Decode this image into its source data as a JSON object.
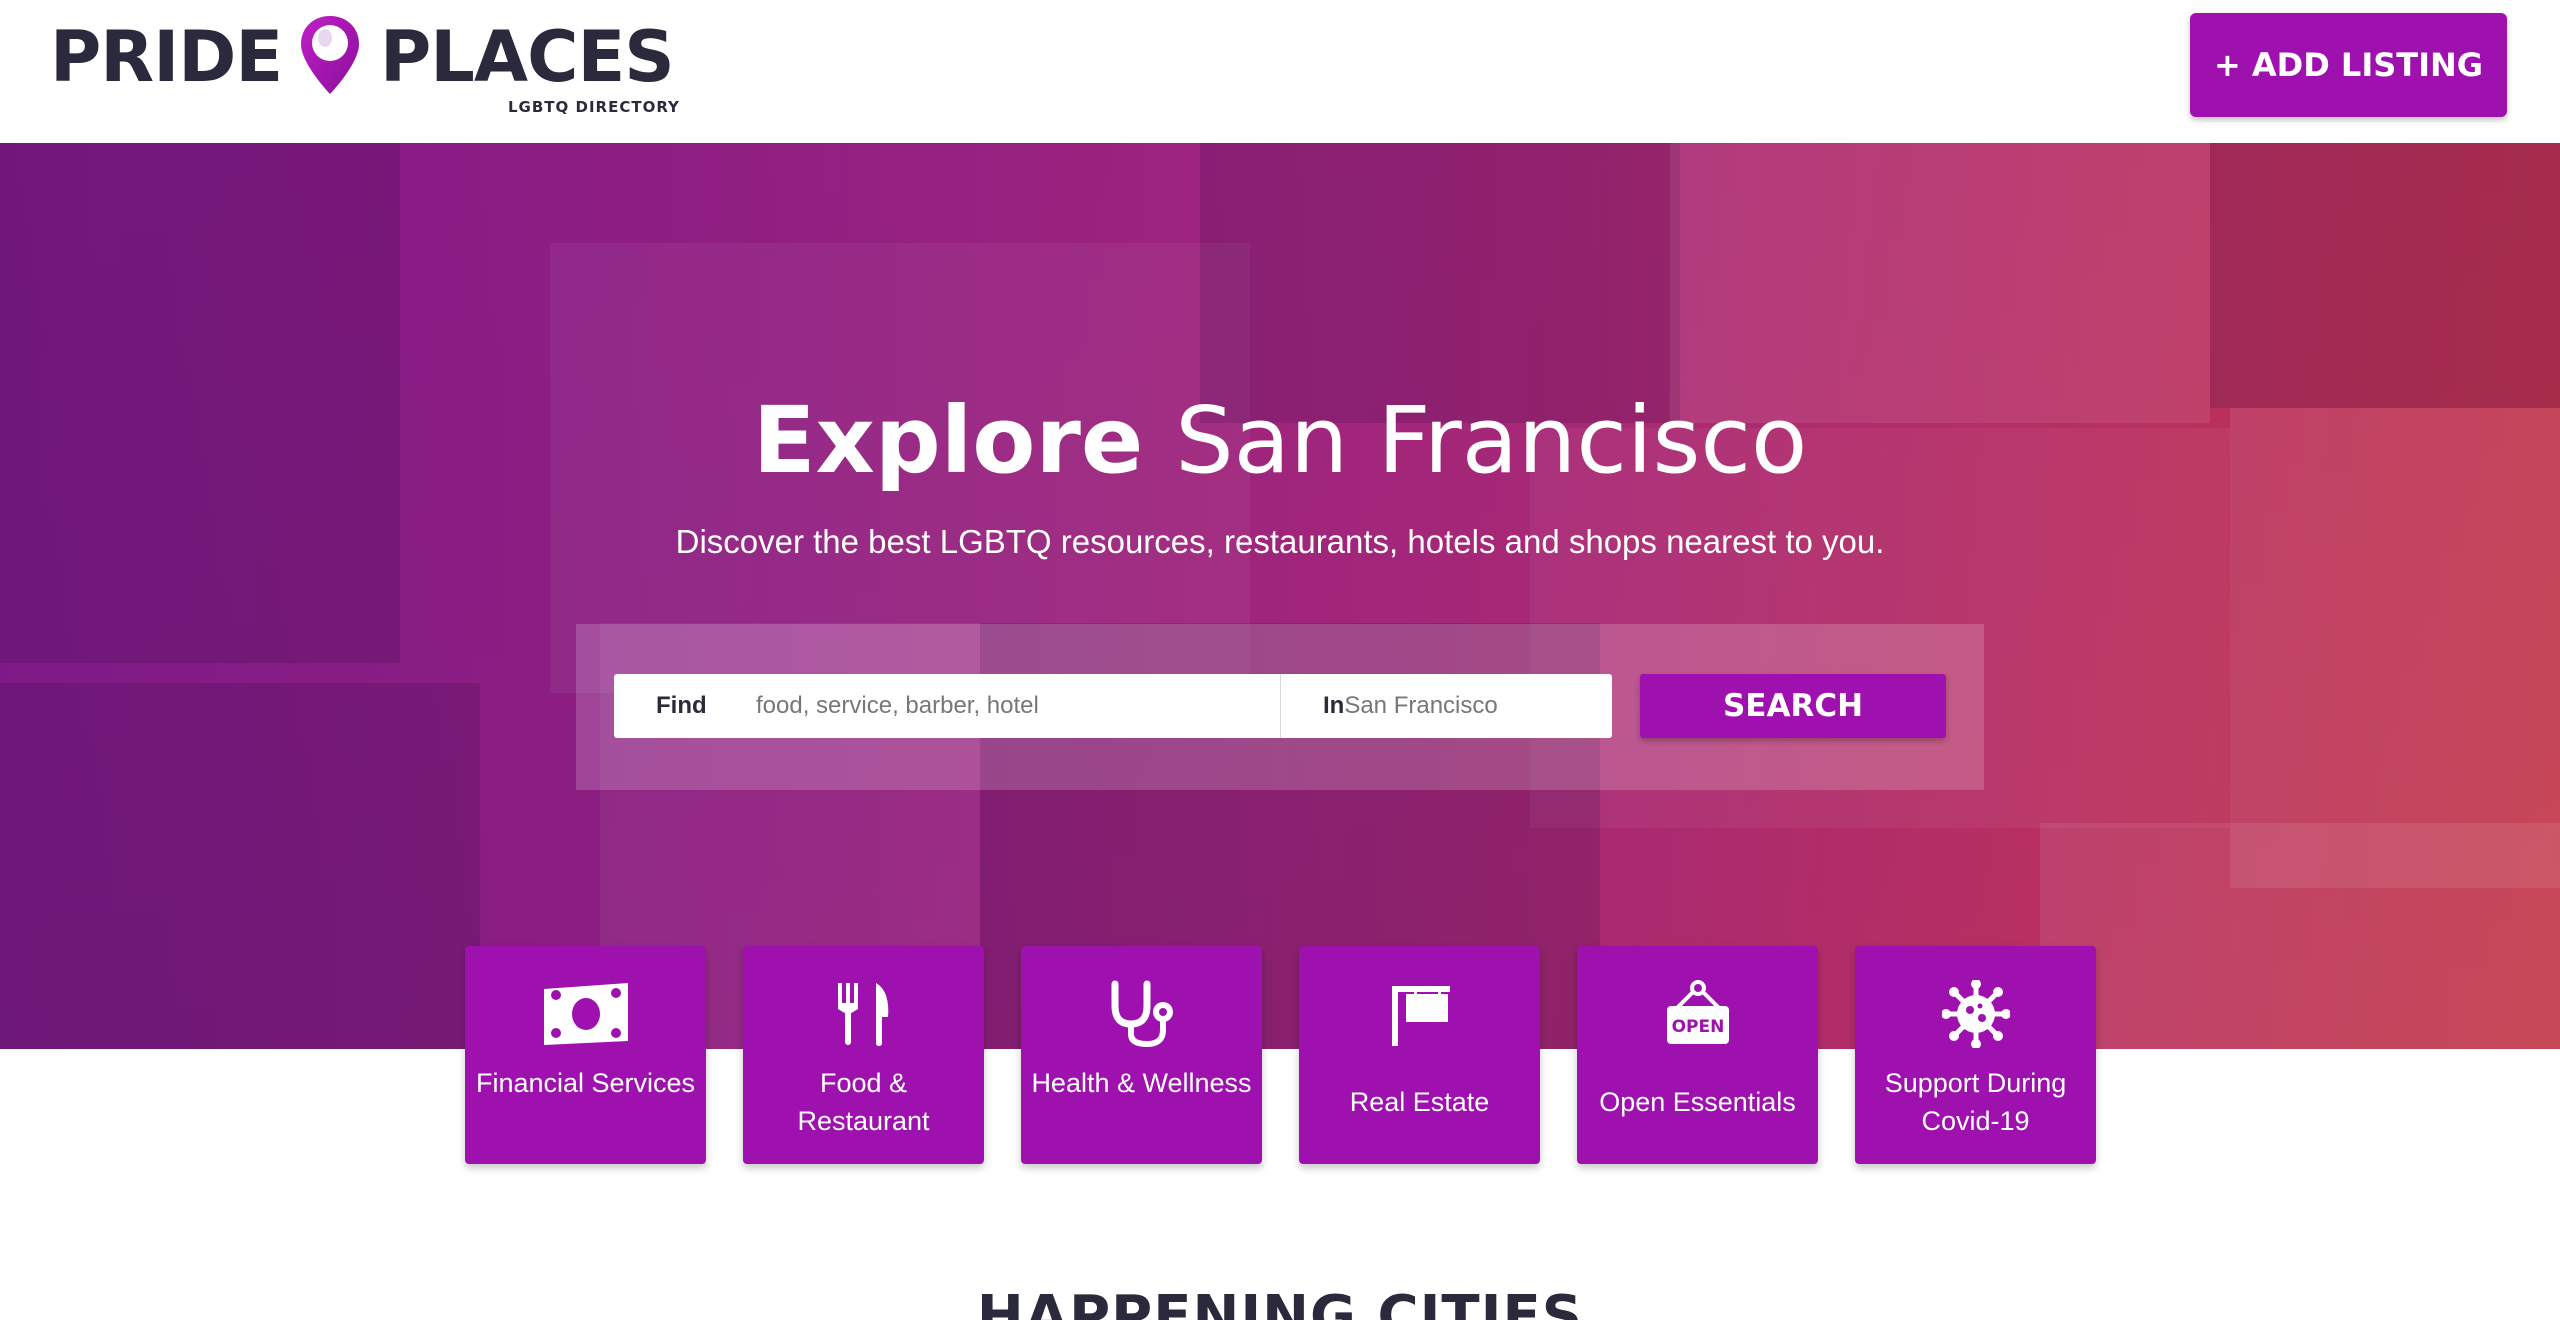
{
  "header": {
    "logo_word_left": "PRIDE",
    "logo_word_right": "PLACES",
    "logo_tagline": "LGBTQ DIRECTORY",
    "add_listing_label": "+ ADD LISTING",
    "brand_color": "#9e11ae"
  },
  "hero": {
    "title_bold": "Explore",
    "title_city": "San Francisco",
    "subtitle": "Discover the best LGBTQ resources, restaurants, hotels and shops nearest to you.",
    "search": {
      "find_label": "Find",
      "find_placeholder": "food, service, barber, hotel",
      "in_label": "In",
      "in_placeholder": "San Francisco",
      "button_label": "SEARCH"
    }
  },
  "categories": [
    {
      "label": "Financial Services",
      "icon": "money-bill-icon"
    },
    {
      "label": "Food & Restaurant",
      "icon": "utensils-icon"
    },
    {
      "label": "Health & Wellness",
      "icon": "stethoscope-icon"
    },
    {
      "label": "Real Estate",
      "icon": "sign-icon"
    },
    {
      "label": "Open Essentials",
      "icon": "open-sign-icon",
      "icon_text": "OPEN"
    },
    {
      "label": "Support During Covid-19",
      "icon": "virus-icon"
    }
  ],
  "section": {
    "title": "HAPPENING CITIES"
  }
}
